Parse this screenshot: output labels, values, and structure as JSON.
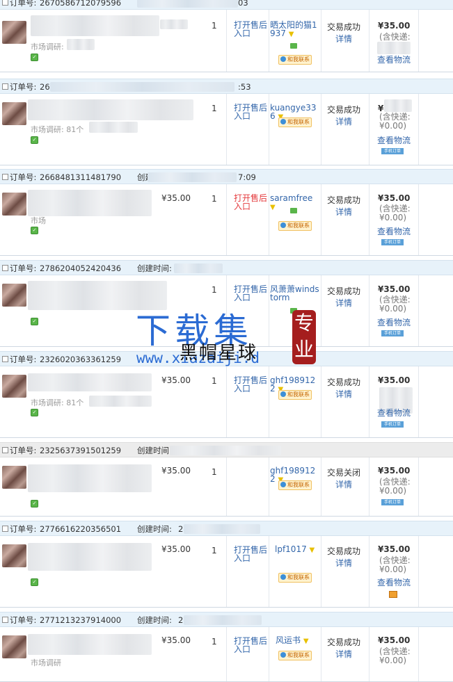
{
  "labels": {
    "order_no": "订单号:",
    "created": "创建时间:",
    "aftersale": "打开售后入口",
    "detail": "详情",
    "logistics": "查看物流",
    "contact": "和我联系",
    "mobile_order": "手机订单"
  },
  "orders": [
    {
      "order_no": "2670586712079596",
      "created_time": "03",
      "price": "",
      "qty": "1",
      "buyer": "晒太阳的猫1937",
      "status": "交易成功",
      "total": "¥35.00",
      "shipping": "(含快递:",
      "item_sub": "市场调研:"
    },
    {
      "order_no": "26",
      "created_time": ":53",
      "price": "",
      "qty": "1",
      "buyer": "kuangye336",
      "status": "交易成功",
      "total": "¥",
      "shipping": "(含快递:\n¥0.00)",
      "item_sub": "市场调研: 81个"
    },
    {
      "order_no": "2668481311481790",
      "created_time": "7:09",
      "price": "¥35.00",
      "qty": "1",
      "buyer": "saramfree",
      "status": "交易成功",
      "total": "¥35.00",
      "shipping": "(含快递:\n¥0.00)",
      "item_sub": "市场"
    },
    {
      "order_no": "2786204052420436",
      "created_time": "",
      "price": "",
      "qty": "1",
      "buyer": "风萧萧windstorm",
      "status": "交易成功",
      "total": "¥35.00",
      "shipping": "(含快递:\n¥0.00)",
      "item_sub": ""
    },
    {
      "order_no": "2326020363361259",
      "created_time": "",
      "price": "¥35.00",
      "qty": "1",
      "buyer": "ghf1989122",
      "status": "交易成功",
      "total": "¥35.00",
      "shipping": "",
      "item_sub": "市场调研: 81个"
    },
    {
      "order_no": "2325637391501259",
      "created_time": "",
      "price": "¥35.00",
      "qty": "1",
      "buyer": "ghf1989122",
      "status": "交易关闭",
      "total": "¥35.00",
      "shipping": "(含快递:\n¥0.00)",
      "item_sub": ""
    },
    {
      "order_no": "2776616220356501",
      "created_time": "2",
      "price": "¥35.00",
      "qty": "1",
      "buyer": "lpf1017",
      "status": "交易成功",
      "total": "¥35.00",
      "shipping": "(含快递:\n¥0.00)",
      "item_sub": ""
    },
    {
      "order_no": "2771213237914000",
      "created_time": "2",
      "price": "¥35.00",
      "qty": "1",
      "buyer": "风运书",
      "status": "交易成功",
      "total": "¥35.00",
      "shipping": "(含快递:\n¥0.00)",
      "item_sub": "市场调研"
    }
  ],
  "watermark": {
    "big": "下载集",
    "seal": "专业",
    "url": "www.xiazaiji.d",
    "black": "黑帽星球"
  }
}
